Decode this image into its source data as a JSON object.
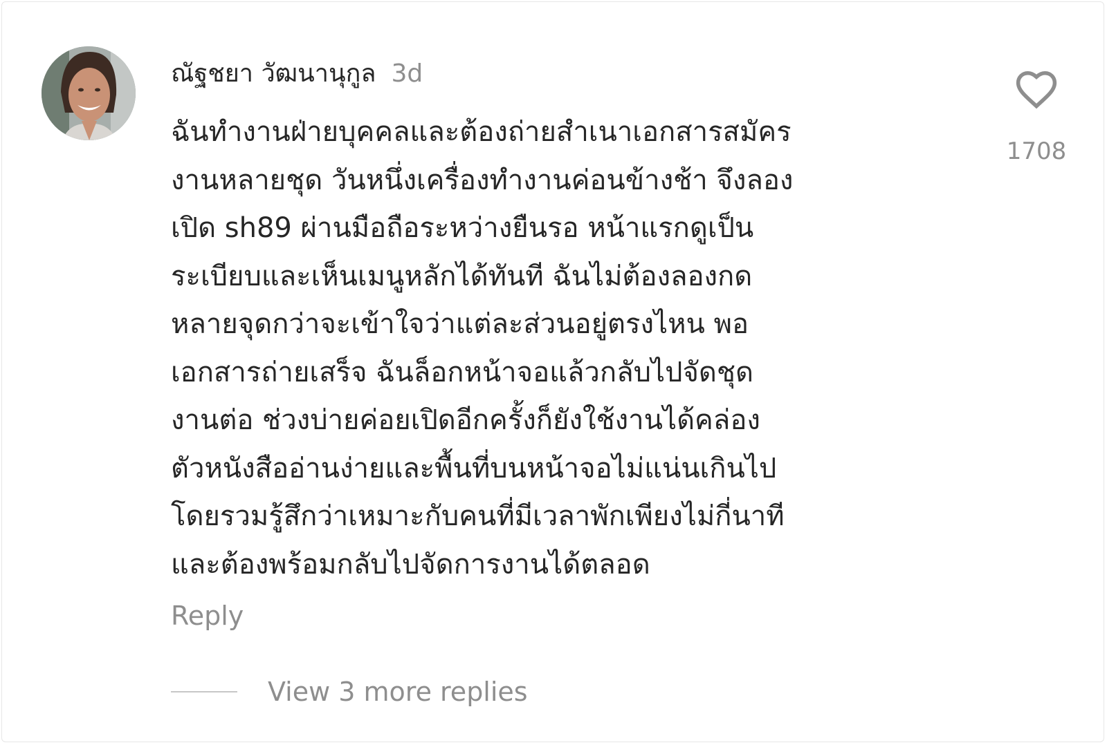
{
  "comment": {
    "author": "ณัฐชยา วัฒนานุกูล",
    "time_ago": "3d",
    "avatar_icon": "user-avatar-photo",
    "body_lines": [
      "ฉันทำงานฝ่ายบุคคลและต้องถ่ายสำเนาเอกสารสมัคร",
      "งานหลายชุด วันหนึ่งเครื่องทำงานค่อนข้างช้า จึงลอง",
      "เปิด sh89 ผ่านมือถือระหว่างยืนรอ หน้าแรกดูเป็น",
      "ระเบียบและเห็นเมนูหลักได้ทันที ฉันไม่ต้องลองกด",
      "หลายจุดกว่าจะเข้าใจว่าแต่ละส่วนอยู่ตรงไหน พอ",
      "เอกสารถ่ายเสร็จ ฉันล็อกหน้าจอแล้วกลับไปจัดชุด",
      "งานต่อ ช่วงบ่ายค่อยเปิดอีกครั้งก็ยังใช้งานได้คล่อง",
      "ตัวหนังสืออ่านง่ายและพื้นที่บนหน้าจอไม่แน่นเกินไป",
      "โดยรวมรู้สึกว่าเหมาะกับคนที่มีเวลาพักเพียงไม่กี่นาที",
      "และต้องพร้อมกลับไปจัดการงานได้ตลอด"
    ],
    "like_icon": "heart-outline-icon",
    "like_count": "1708",
    "reply_label": "Reply",
    "view_replies_label": "View 3 more replies"
  },
  "colors": {
    "text_primary": "#262626",
    "text_secondary": "#8e8e8e",
    "divider": "#c7c7c7",
    "icon": "#8e8e8e"
  }
}
